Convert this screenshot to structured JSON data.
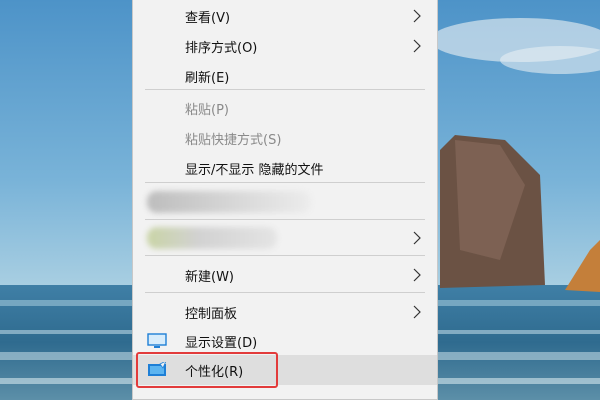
{
  "menu": {
    "items": [
      {
        "label": "查看(V)",
        "submenu": true
      },
      {
        "label": "排序方式(O)",
        "submenu": true
      },
      {
        "label": "刷新(E)"
      },
      {
        "label": "粘贴(P)",
        "disabled": true
      },
      {
        "label": "粘贴快捷方式(S)",
        "disabled": true
      },
      {
        "label": "显示/不显示 隐藏的文件"
      },
      {
        "label": "新建(W)",
        "submenu": true
      },
      {
        "label": "控制面板",
        "submenu": true
      },
      {
        "label": "显示设置(D)",
        "icon": "display-settings-icon"
      },
      {
        "label": "个性化(R)",
        "icon": "personalize-icon",
        "highlighted": true
      }
    ]
  },
  "colors": {
    "menu_background": "#f2f2f2",
    "highlight_box": "#e23b3b",
    "icon_blue": "#1e7fd6"
  }
}
